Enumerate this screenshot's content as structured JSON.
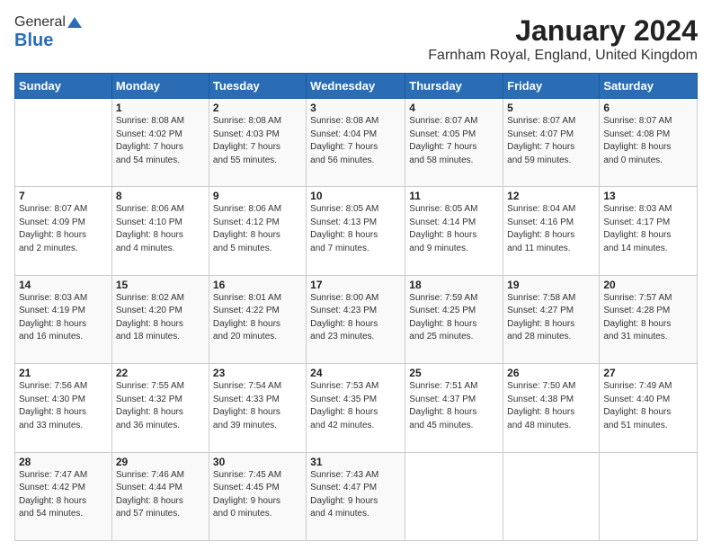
{
  "logo": {
    "line1": "General",
    "line2": "Blue"
  },
  "title": "January 2024",
  "subtitle": "Farnham Royal, England, United Kingdom",
  "weekdays": [
    "Sunday",
    "Monday",
    "Tuesday",
    "Wednesday",
    "Thursday",
    "Friday",
    "Saturday"
  ],
  "weeks": [
    [
      {
        "day": "",
        "info": ""
      },
      {
        "day": "1",
        "info": "Sunrise: 8:08 AM\nSunset: 4:02 PM\nDaylight: 7 hours\nand 54 minutes."
      },
      {
        "day": "2",
        "info": "Sunrise: 8:08 AM\nSunset: 4:03 PM\nDaylight: 7 hours\nand 55 minutes."
      },
      {
        "day": "3",
        "info": "Sunrise: 8:08 AM\nSunset: 4:04 PM\nDaylight: 7 hours\nand 56 minutes."
      },
      {
        "day": "4",
        "info": "Sunrise: 8:07 AM\nSunset: 4:05 PM\nDaylight: 7 hours\nand 58 minutes."
      },
      {
        "day": "5",
        "info": "Sunrise: 8:07 AM\nSunset: 4:07 PM\nDaylight: 7 hours\nand 59 minutes."
      },
      {
        "day": "6",
        "info": "Sunrise: 8:07 AM\nSunset: 4:08 PM\nDaylight: 8 hours\nand 0 minutes."
      }
    ],
    [
      {
        "day": "7",
        "info": "Sunrise: 8:07 AM\nSunset: 4:09 PM\nDaylight: 8 hours\nand 2 minutes."
      },
      {
        "day": "8",
        "info": "Sunrise: 8:06 AM\nSunset: 4:10 PM\nDaylight: 8 hours\nand 4 minutes."
      },
      {
        "day": "9",
        "info": "Sunrise: 8:06 AM\nSunset: 4:12 PM\nDaylight: 8 hours\nand 5 minutes."
      },
      {
        "day": "10",
        "info": "Sunrise: 8:05 AM\nSunset: 4:13 PM\nDaylight: 8 hours\nand 7 minutes."
      },
      {
        "day": "11",
        "info": "Sunrise: 8:05 AM\nSunset: 4:14 PM\nDaylight: 8 hours\nand 9 minutes."
      },
      {
        "day": "12",
        "info": "Sunrise: 8:04 AM\nSunset: 4:16 PM\nDaylight: 8 hours\nand 11 minutes."
      },
      {
        "day": "13",
        "info": "Sunrise: 8:03 AM\nSunset: 4:17 PM\nDaylight: 8 hours\nand 14 minutes."
      }
    ],
    [
      {
        "day": "14",
        "info": "Sunrise: 8:03 AM\nSunset: 4:19 PM\nDaylight: 8 hours\nand 16 minutes."
      },
      {
        "day": "15",
        "info": "Sunrise: 8:02 AM\nSunset: 4:20 PM\nDaylight: 8 hours\nand 18 minutes."
      },
      {
        "day": "16",
        "info": "Sunrise: 8:01 AM\nSunset: 4:22 PM\nDaylight: 8 hours\nand 20 minutes."
      },
      {
        "day": "17",
        "info": "Sunrise: 8:00 AM\nSunset: 4:23 PM\nDaylight: 8 hours\nand 23 minutes."
      },
      {
        "day": "18",
        "info": "Sunrise: 7:59 AM\nSunset: 4:25 PM\nDaylight: 8 hours\nand 25 minutes."
      },
      {
        "day": "19",
        "info": "Sunrise: 7:58 AM\nSunset: 4:27 PM\nDaylight: 8 hours\nand 28 minutes."
      },
      {
        "day": "20",
        "info": "Sunrise: 7:57 AM\nSunset: 4:28 PM\nDaylight: 8 hours\nand 31 minutes."
      }
    ],
    [
      {
        "day": "21",
        "info": "Sunrise: 7:56 AM\nSunset: 4:30 PM\nDaylight: 8 hours\nand 33 minutes."
      },
      {
        "day": "22",
        "info": "Sunrise: 7:55 AM\nSunset: 4:32 PM\nDaylight: 8 hours\nand 36 minutes."
      },
      {
        "day": "23",
        "info": "Sunrise: 7:54 AM\nSunset: 4:33 PM\nDaylight: 8 hours\nand 39 minutes."
      },
      {
        "day": "24",
        "info": "Sunrise: 7:53 AM\nSunset: 4:35 PM\nDaylight: 8 hours\nand 42 minutes."
      },
      {
        "day": "25",
        "info": "Sunrise: 7:51 AM\nSunset: 4:37 PM\nDaylight: 8 hours\nand 45 minutes."
      },
      {
        "day": "26",
        "info": "Sunrise: 7:50 AM\nSunset: 4:38 PM\nDaylight: 8 hours\nand 48 minutes."
      },
      {
        "day": "27",
        "info": "Sunrise: 7:49 AM\nSunset: 4:40 PM\nDaylight: 8 hours\nand 51 minutes."
      }
    ],
    [
      {
        "day": "28",
        "info": "Sunrise: 7:47 AM\nSunset: 4:42 PM\nDaylight: 8 hours\nand 54 minutes."
      },
      {
        "day": "29",
        "info": "Sunrise: 7:46 AM\nSunset: 4:44 PM\nDaylight: 8 hours\nand 57 minutes."
      },
      {
        "day": "30",
        "info": "Sunrise: 7:45 AM\nSunset: 4:45 PM\nDaylight: 9 hours\nand 0 minutes."
      },
      {
        "day": "31",
        "info": "Sunrise: 7:43 AM\nSunset: 4:47 PM\nDaylight: 9 hours\nand 4 minutes."
      },
      {
        "day": "",
        "info": ""
      },
      {
        "day": "",
        "info": ""
      },
      {
        "day": "",
        "info": ""
      }
    ]
  ]
}
